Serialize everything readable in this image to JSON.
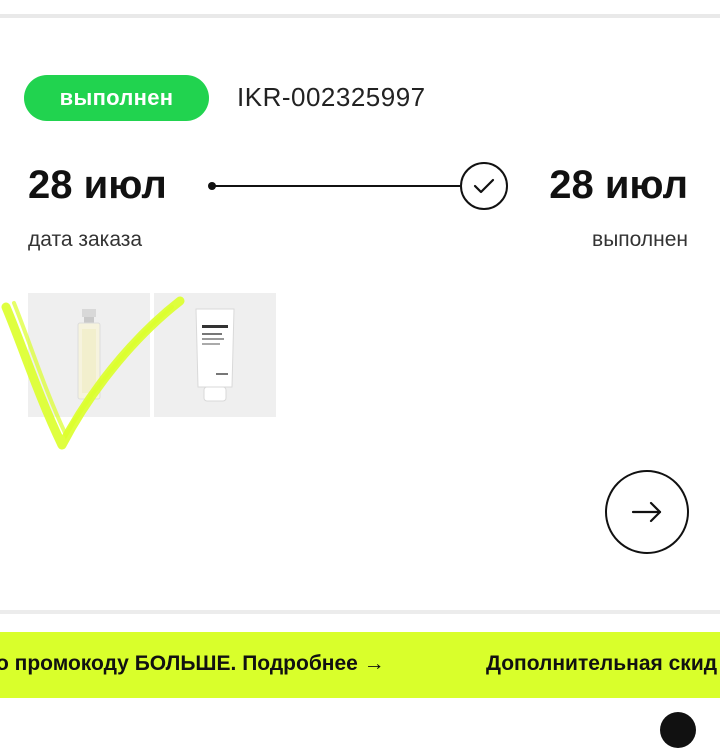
{
  "order": {
    "status_label": "выполнен",
    "number": "IKR-002325997",
    "order_date": "28 июл",
    "order_date_caption": "дата заказа",
    "completed_date": "28 июл",
    "completed_caption": "выполнен"
  },
  "items": [
    {
      "name": "perfume-bottle"
    },
    {
      "name": "Dermaclear pH 5.5 Cleanser",
      "brand": "Dr.Jart+"
    }
  ],
  "banner": {
    "text_1": "о промокоду БОЛЬШЕ. Подробнее →",
    "text_2": "Дополнительная скид"
  },
  "icons": {
    "check": "check-circle-icon",
    "arrow": "arrow-right-icon"
  },
  "colors": {
    "status_green": "#21d34f",
    "banner_lime": "#d9ff2b",
    "check_overlay": "#dcff2a"
  }
}
